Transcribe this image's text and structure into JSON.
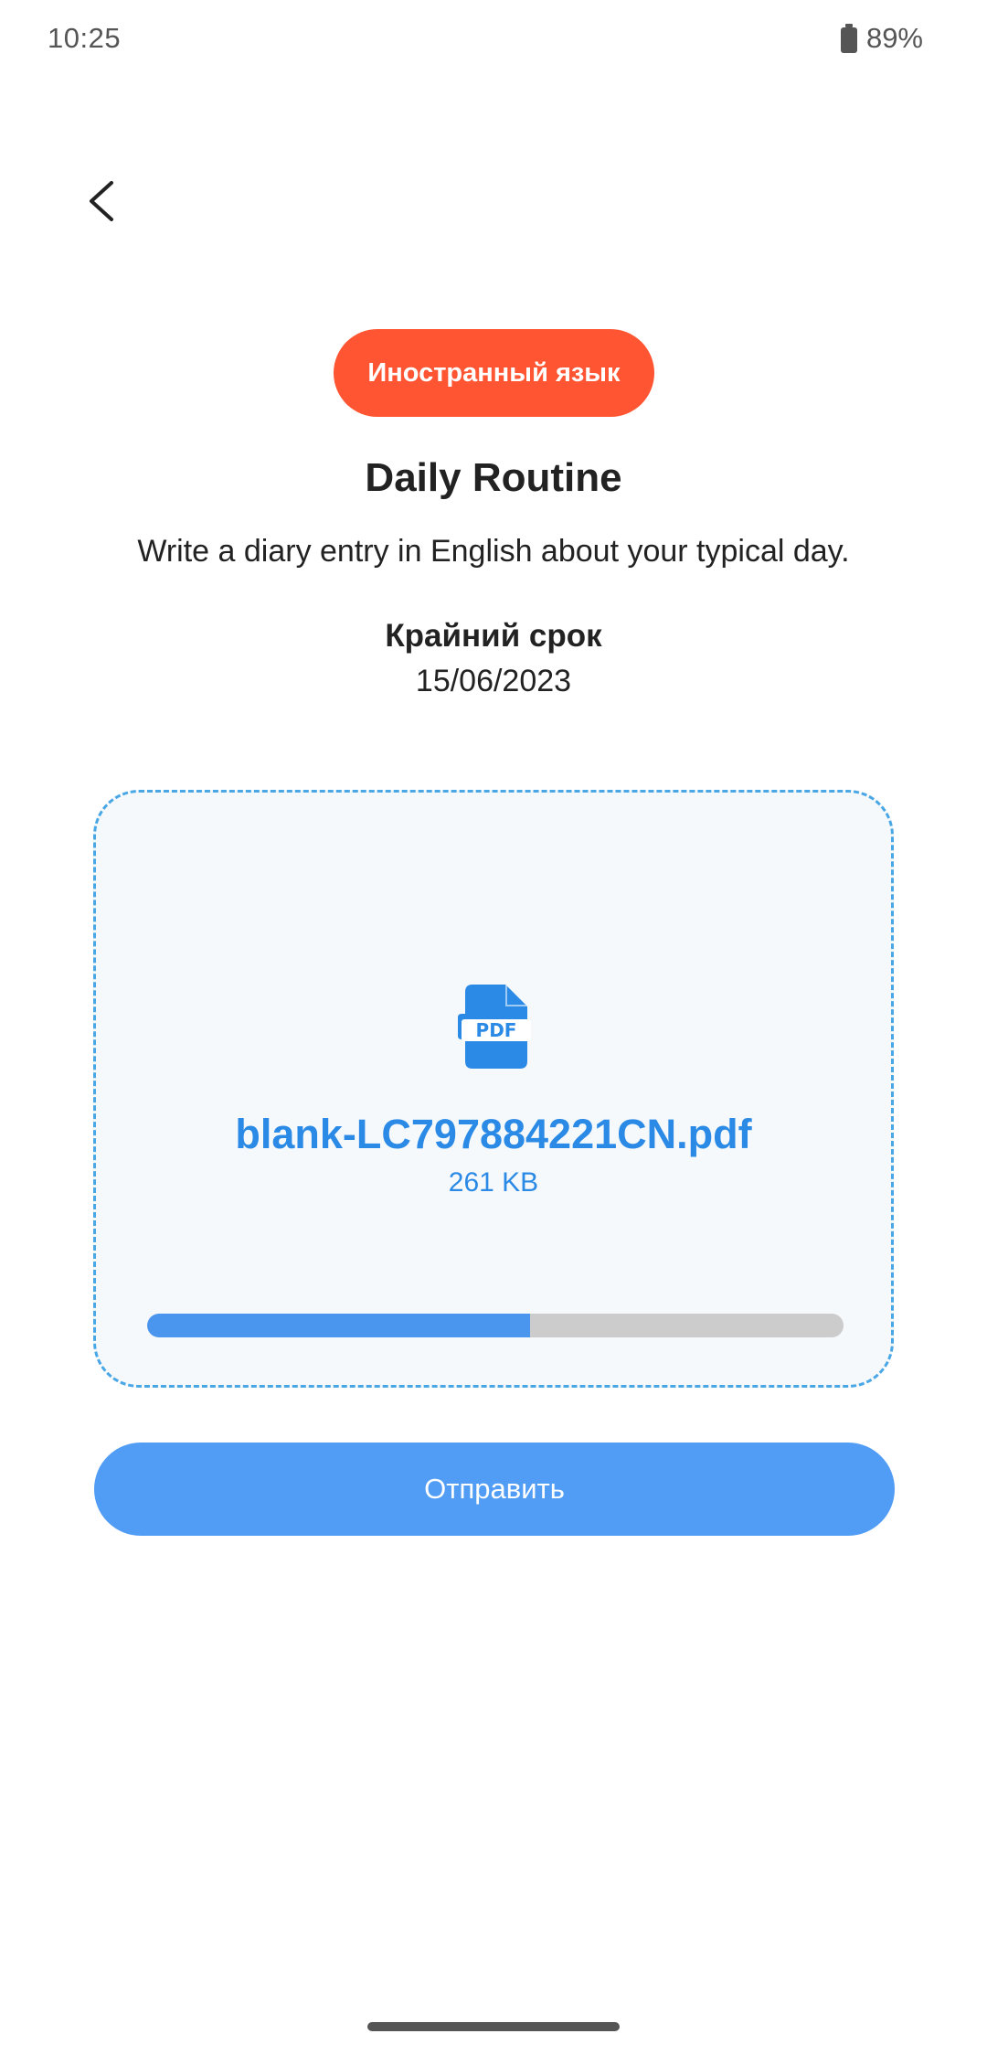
{
  "status_bar": {
    "time": "10:25",
    "battery_percent": "89%",
    "battery_icon": "battery-full-icon"
  },
  "navigation": {
    "back_icon": "chevron-left-icon"
  },
  "assignment": {
    "subject": "Иностранный язык",
    "title": "Daily Routine",
    "description": "Write a diary entry in English about your typical day.",
    "deadline_label": "Крайний срок",
    "deadline_date": "15/06/2023"
  },
  "upload": {
    "file_icon": "pdf-file-icon",
    "file_name": "blank-LC797884221CN.pdf",
    "file_size": "261 KB",
    "progress": 0.55
  },
  "actions": {
    "send_label": "Отправить"
  },
  "colors": {
    "accent": "#519cf5",
    "chip": "#ff5533",
    "file_text": "#2b8ae5",
    "progress_fill": "#4a96ee",
    "progress_track": "#cccccc",
    "card_border": "#4aa7e6"
  }
}
